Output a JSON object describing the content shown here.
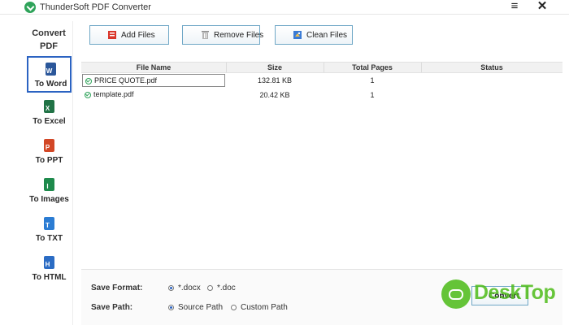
{
  "window": {
    "title": "ThunderSoft PDF Converter",
    "menu_glyph": "≡",
    "close_glyph": "✕"
  },
  "sidebar": {
    "title": "Convert\nPDF",
    "items": [
      {
        "label": "To Word",
        "icon": "word-icon",
        "color": "#2b579a",
        "glyph": "W",
        "active": true
      },
      {
        "label": "To Excel",
        "icon": "excel-icon",
        "color": "#217346",
        "glyph": "X",
        "active": false
      },
      {
        "label": "To PPT",
        "icon": "ppt-icon",
        "color": "#d24726",
        "glyph": "P",
        "active": false
      },
      {
        "label": "To Images",
        "icon": "images-icon",
        "color": "#1e8a4c",
        "glyph": "I",
        "active": false
      },
      {
        "label": "To TXT",
        "icon": "txt-icon",
        "color": "#2b7cd3",
        "glyph": "T",
        "active": false
      },
      {
        "label": "To HTML",
        "icon": "html-icon",
        "color": "#2b6cc4",
        "glyph": "H",
        "active": false
      }
    ]
  },
  "toolbar": {
    "add_label": "Add Files",
    "remove_label": "Remove Files",
    "clean_label": "Clean Files"
  },
  "table": {
    "headers": {
      "name": "File Name",
      "size": "Size",
      "pages": "Total Pages",
      "status": "Status"
    },
    "rows": [
      {
        "name": "PRICE QUOTE.pdf",
        "size": "132.81 KB",
        "pages": "1",
        "status": ""
      },
      {
        "name": "template.pdf",
        "size": "20.42 KB",
        "pages": "1",
        "status": ""
      }
    ]
  },
  "settings": {
    "format_label": "Save Format:",
    "format_options": [
      "*.docx",
      "*.doc"
    ],
    "format_selected": "*.docx",
    "path_label": "Save Path:",
    "path_options": [
      "Source Path",
      "Custom Path"
    ],
    "path_selected": "Source Path",
    "convert_label": "Convert"
  },
  "watermark": {
    "text": "DeskTop"
  },
  "colors": {
    "accent": "#2b63c2",
    "button_border": "#6fa7c6",
    "success": "#2fa35a",
    "watermark": "#4cbb17"
  }
}
